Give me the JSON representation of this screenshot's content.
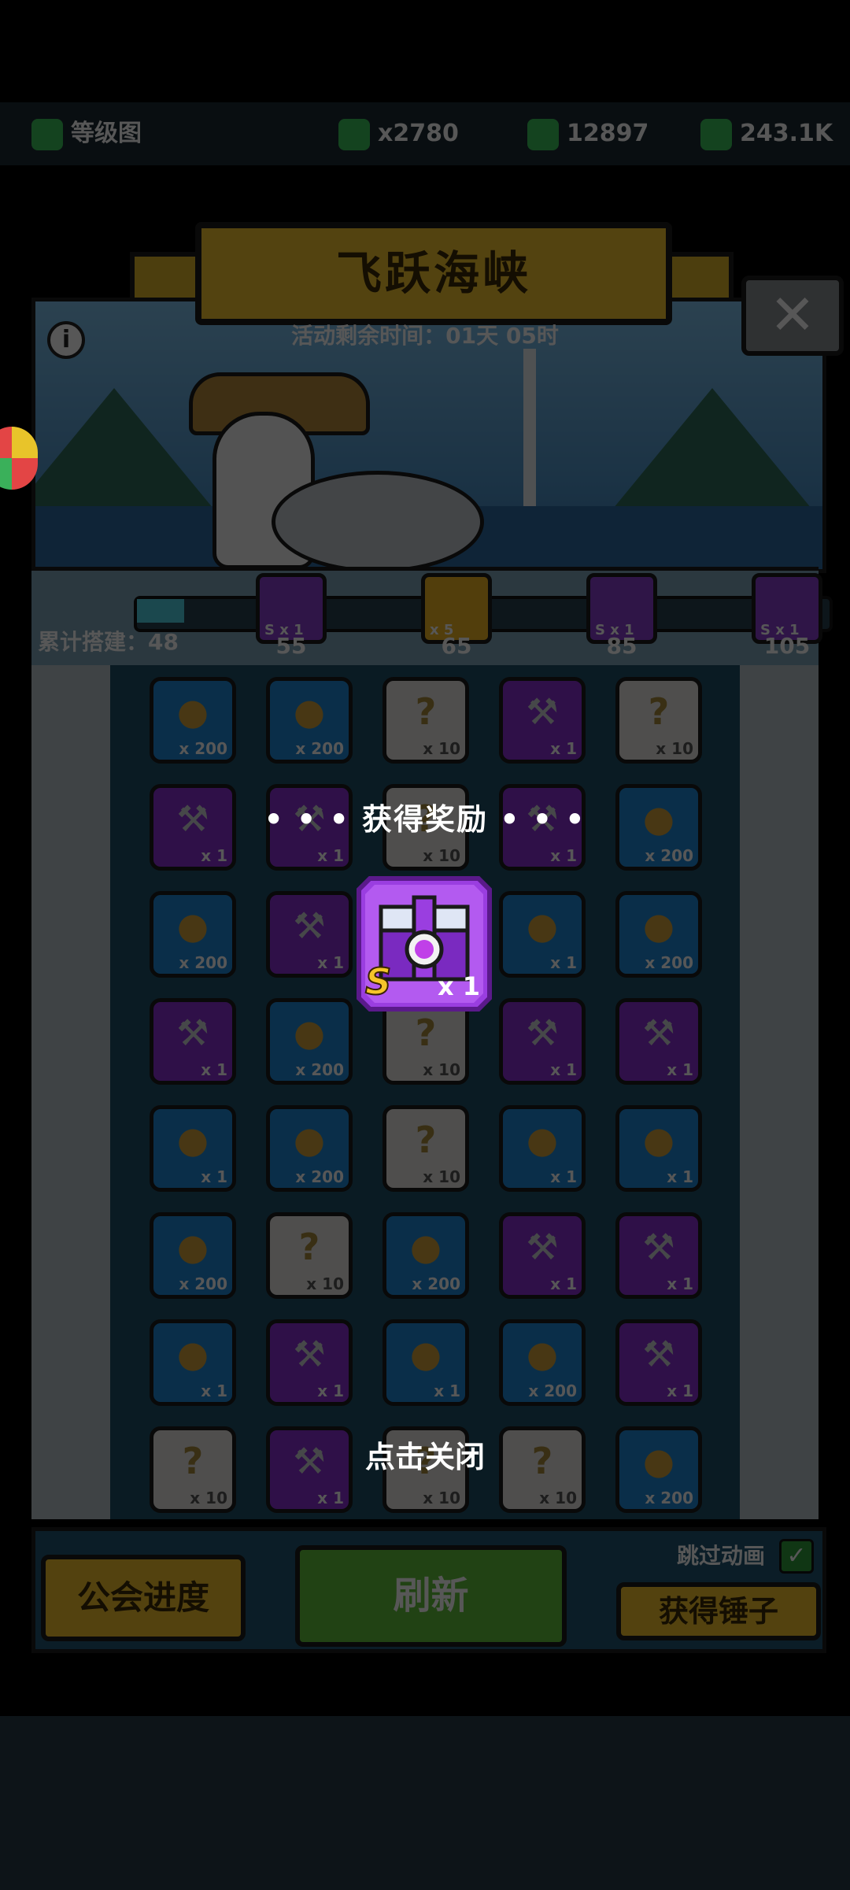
{
  "top_bar": {
    "player_label": "等级图",
    "currency_1": "x2780",
    "currency_2": "12897",
    "currency_3": "243.1K"
  },
  "event": {
    "title": "飞跃海峡",
    "timer_text": "活动剩余时间：01天 05时",
    "total_built_label": "累计搭建：48"
  },
  "milestones": [
    {
      "value": "55",
      "color": "#8a3ed0",
      "badge": "S x 1"
    },
    {
      "value": "65",
      "color": "#f0b623",
      "badge": "x 5"
    },
    {
      "value": "85",
      "color": "#8a3ed0",
      "badge": "S x 1"
    },
    {
      "value": "105",
      "color": "#8a3ed0",
      "badge": "S x 1"
    }
  ],
  "grid": [
    [
      {
        "t": "blue",
        "q": "x 200"
      },
      {
        "t": "blue",
        "q": "x 200"
      },
      {
        "t": "gray",
        "q": "x 10"
      },
      {
        "t": "purple",
        "q": "x 1"
      },
      {
        "t": "gray",
        "q": "x 10"
      }
    ],
    [
      {
        "t": "purple",
        "q": "x 1"
      },
      {
        "t": "purple",
        "q": "x 1"
      },
      {
        "t": "gray",
        "q": "x 10"
      },
      {
        "t": "purple",
        "q": "x 1"
      },
      {
        "t": "blue",
        "q": "x 200"
      }
    ],
    [
      {
        "t": "blue",
        "q": "x 200"
      },
      {
        "t": "purple",
        "q": "x 1"
      },
      {
        "t": "blue",
        "q": "x 1"
      },
      {
        "t": "blue",
        "q": "x 1"
      },
      {
        "t": "blue",
        "q": "x 200"
      }
    ],
    [
      {
        "t": "purple",
        "q": "x 1"
      },
      {
        "t": "blue",
        "q": "x 200"
      },
      {
        "t": "gray",
        "q": "x 10"
      },
      {
        "t": "purple",
        "q": "x 1"
      },
      {
        "t": "purple",
        "q": "x 1"
      }
    ],
    [
      {
        "t": "blue",
        "q": "x 1"
      },
      {
        "t": "blue",
        "q": "x 200"
      },
      {
        "t": "gray",
        "q": "x 10"
      },
      {
        "t": "blue",
        "q": "x 1"
      },
      {
        "t": "blue",
        "q": "x 1"
      }
    ],
    [
      {
        "t": "blue",
        "q": "x 200"
      },
      {
        "t": "gray",
        "q": "x 10"
      },
      {
        "t": "blue",
        "q": "x 200"
      },
      {
        "t": "purple",
        "q": "x 1"
      },
      {
        "t": "purple",
        "q": "x 1"
      }
    ],
    [
      {
        "t": "blue",
        "q": "x 1"
      },
      {
        "t": "purple",
        "q": "x 1"
      },
      {
        "t": "blue",
        "q": "x 1"
      },
      {
        "t": "blue",
        "q": "x 200"
      },
      {
        "t": "purple",
        "q": "x 1"
      }
    ],
    [
      {
        "t": "gray",
        "q": "x 10"
      },
      {
        "t": "purple",
        "q": "x 1"
      },
      {
        "t": "gray",
        "q": "x 10"
      },
      {
        "t": "gray",
        "q": "x 10"
      },
      {
        "t": "blue",
        "q": "x 200"
      }
    ]
  ],
  "buttons": {
    "guild_progress": "公会进度",
    "refresh": "刷新",
    "get_hammer": "获得锤子",
    "skip_animation": "跳过动画"
  },
  "reward_popup": {
    "title": "• • •  获得奖励  • • •",
    "item_grade": "S",
    "item_qty": "x 1",
    "close_hint": "点击关闭"
  }
}
